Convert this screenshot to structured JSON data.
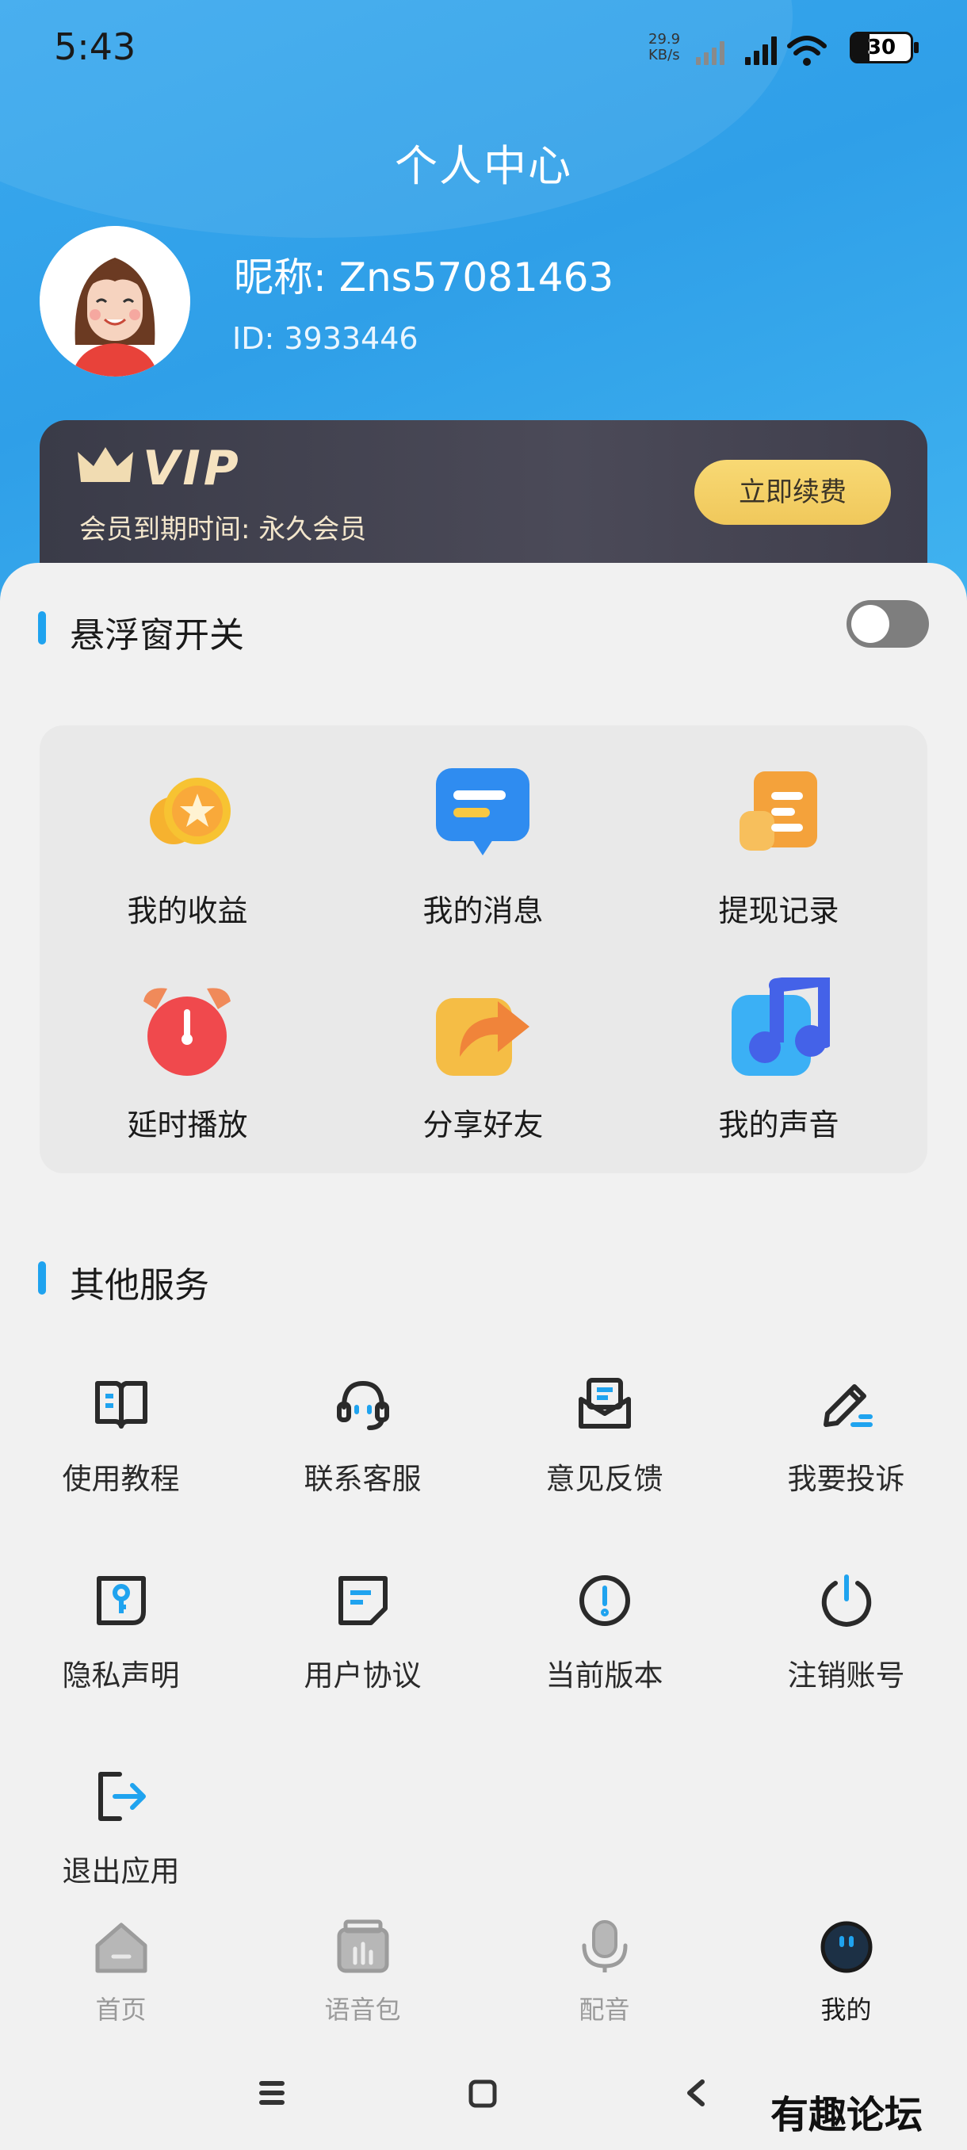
{
  "status_bar": {
    "time": "5:43",
    "net_speed_value": "29.9",
    "net_speed_unit": "KB/s",
    "battery": "30"
  },
  "header": {
    "title": "个人中心",
    "nickname": "昵称: Zns57081463",
    "user_id": "ID: 3933446"
  },
  "vip": {
    "badge": "VIP",
    "expire_text": "会员到期时间: 永久会员",
    "renew_label": "立即续费"
  },
  "floating_window": {
    "title": "悬浮窗开关",
    "enabled": false
  },
  "features": [
    {
      "label": "我的收益",
      "icon": "coins-icon"
    },
    {
      "label": "我的消息",
      "icon": "message-icon"
    },
    {
      "label": "提现记录",
      "icon": "record-icon"
    },
    {
      "label": "延时播放",
      "icon": "alarm-clock-icon"
    },
    {
      "label": "分享好友",
      "icon": "share-icon"
    },
    {
      "label": "我的声音",
      "icon": "music-note-icon"
    }
  ],
  "services": {
    "title": "其他服务",
    "items": [
      {
        "label": "使用教程",
        "icon": "book-icon"
      },
      {
        "label": "联系客服",
        "icon": "headset-icon"
      },
      {
        "label": "意见反馈",
        "icon": "mail-feedback-icon"
      },
      {
        "label": "我要投诉",
        "icon": "pen-icon"
      },
      {
        "label": "隐私声明",
        "icon": "privacy-key-icon"
      },
      {
        "label": "用户协议",
        "icon": "document-icon"
      },
      {
        "label": "当前版本",
        "icon": "info-icon"
      },
      {
        "label": "注销账号",
        "icon": "power-icon"
      },
      {
        "label": "退出应用",
        "icon": "logout-icon"
      }
    ]
  },
  "bottom_nav": [
    {
      "label": "首页",
      "icon": "home-icon",
      "active": false
    },
    {
      "label": "语音包",
      "icon": "voice-pack-icon",
      "active": false
    },
    {
      "label": "配音",
      "icon": "microphone-icon",
      "active": false
    },
    {
      "label": "我的",
      "icon": "profile-icon",
      "active": true
    }
  ],
  "watermark": "有趣论坛",
  "colors": {
    "accent": "#1fa3ef",
    "header": "#35a6ec",
    "vip_card": "#41404e",
    "renew_button": "#f3cf63"
  }
}
